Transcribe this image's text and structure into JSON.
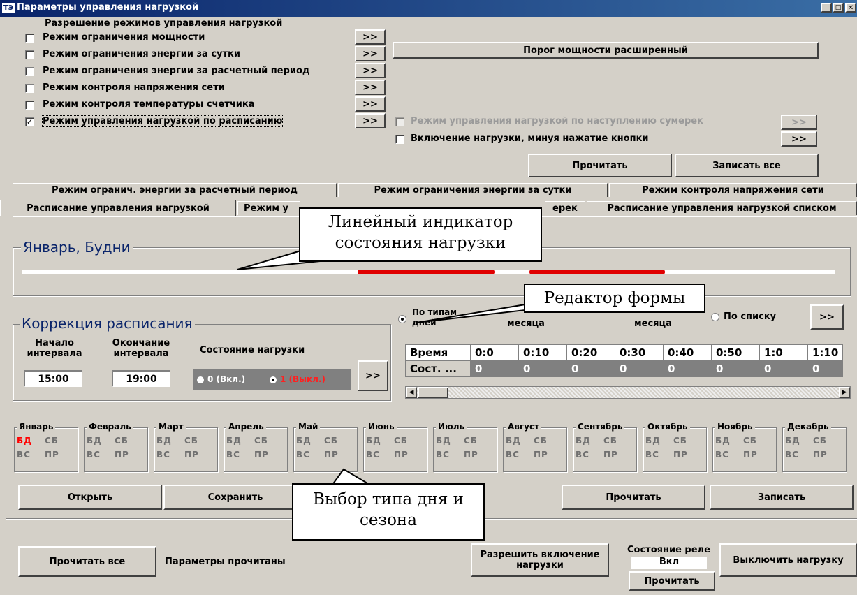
{
  "window": {
    "title": "Параметры управления нагрузкой",
    "app_icon": "ТЭ"
  },
  "modes": {
    "header": "Разрешение режимов управления нагрузкой",
    "items": [
      {
        "label": "Режим ограничения мощности",
        "checked": false,
        "btn": ">>"
      },
      {
        "label": "Режим ограничения энергии за сутки",
        "checked": false,
        "btn": ">>"
      },
      {
        "label": "Режим ограничения энергии за расчетный период",
        "checked": false,
        "btn": ">>"
      },
      {
        "label": "Режим контроля напряжения сети",
        "checked": false,
        "btn": ">>"
      },
      {
        "label": "Режим контроля температуры счетчика",
        "checked": false,
        "btn": ">>"
      },
      {
        "label": "Режим управления нагрузкой по расписанию",
        "checked": true,
        "btn": ">>"
      }
    ],
    "threshold_button": "Порог мощности расширенный",
    "twilight_label": "Режим управления нагрузкой по наступлению сумерек",
    "bypass_label": "Включение нагрузки, минуя нажатие кнопки",
    "read_button": "Прочитать",
    "write_all_button": "Записать все",
    "arrow": ">>",
    "check_mark": "✓"
  },
  "tabs": {
    "row1": [
      "Режим огранич. энергии за расчетный период",
      "Режим ограничения энергии за сутки",
      "Режим контроля напряжения сети"
    ],
    "row2_active": "Расписание управления нагрузкой",
    "row2_b": "Режим у",
    "row2_c": "ерек",
    "row2_d": "Расписание управления нагрузкой списком"
  },
  "indicator": {
    "title": "Январь, Будни",
    "on_color": "#ff0000",
    "off_color": "#ffffff",
    "segments": [
      {
        "start": "15:00",
        "end": "19:00"
      }
    ]
  },
  "correction": {
    "title": "Коррекция расписания",
    "start_label": "Начало интервала",
    "end_label": "Окончание интервала",
    "state_label": "Состояние нагрузки",
    "start_value": "15:00",
    "end_value": "19:00",
    "opt_on": "0 (Вкл.)",
    "opt_off": "1 (Выкл.)",
    "btn": ">>"
  },
  "editor": {
    "radio_days": "По типам дней",
    "radio_month1": "месяца",
    "radio_month2": "месяца",
    "radio_list": "По списку",
    "btn": ">>",
    "header": [
      "Время",
      "0:0",
      "0:10",
      "0:20",
      "0:30",
      "0:40",
      "0:50",
      "1:0",
      "1:10"
    ],
    "row": [
      "Сост. ...",
      "0",
      "0",
      "0",
      "0",
      "0",
      "0",
      "0",
      "0"
    ]
  },
  "months": [
    "Январь",
    "Февраль",
    "Март",
    "Апрель",
    "Май",
    "Июнь",
    "Июль",
    "Август",
    "Сентябрь",
    "Октябрь",
    "Ноябрь",
    "Декабрь"
  ],
  "day_types": {
    "wd": "БД",
    "sat": "СБ",
    "sun": "ВС",
    "hol": "ПР"
  },
  "bottom_buttons": {
    "open": "Открыть",
    "save": "Сохранить",
    "read": "Прочитать",
    "write": "Записать"
  },
  "footer": {
    "read_all": "Прочитать все",
    "status": "Параметры прочитаны",
    "allow_btn": "Разрешить включение нагрузки",
    "relay_label": "Состояние реле",
    "relay_value": "Вкл",
    "relay_read": "Прочитать",
    "disable_btn": "Выключить нагрузку"
  },
  "callouts": {
    "indicator": "Линейный индикатор состояния нагрузки",
    "editor": "Редактор формы",
    "season": "Выбор типа дня и сезона"
  },
  "colors": {
    "titlebar": "#0a246a",
    "face": "#d4d0c8",
    "selected_daytype": "#ff0000"
  }
}
